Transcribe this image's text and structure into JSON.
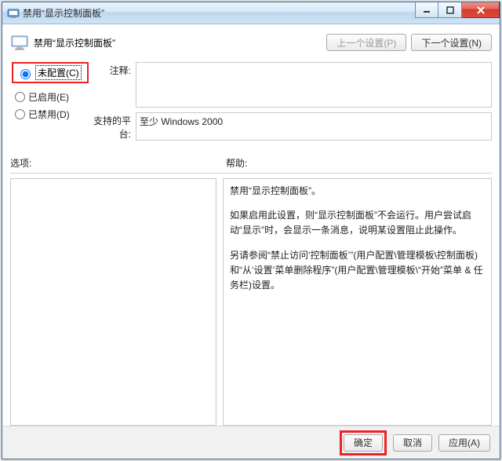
{
  "title": "禁用“显示控制面板”",
  "header_title": "禁用“显示控制面板”",
  "nav": {
    "prev": "上一个设置(P)",
    "next": "下一个设置(N)"
  },
  "radios": {
    "not_configured": "未配置(C)",
    "enabled": "已启用(E)",
    "disabled": "已禁用(D)"
  },
  "labels": {
    "comment": "注释:",
    "supported": "支持的平台:",
    "options": "选项:",
    "help": "帮助:"
  },
  "supported_text": "至少 Windows 2000",
  "help_paragraphs": {
    "p1": "禁用“显示控制面板”。",
    "p2": "如果启用此设置，则“显示控制面板”不会运行。用户尝试启动“显示”时，会显示一条消息，说明某设置阻止此操作。",
    "p3": "另请参阅“禁止访问‘控制面板’”(用户配置\\管理模板\\控制面板)和“从‘设置’菜单删除程序”(用户配置\\管理模板\\“开始”菜单 & 任务栏)设置。"
  },
  "buttons": {
    "ok": "确定",
    "cancel": "取消",
    "apply": "应用(A)"
  }
}
